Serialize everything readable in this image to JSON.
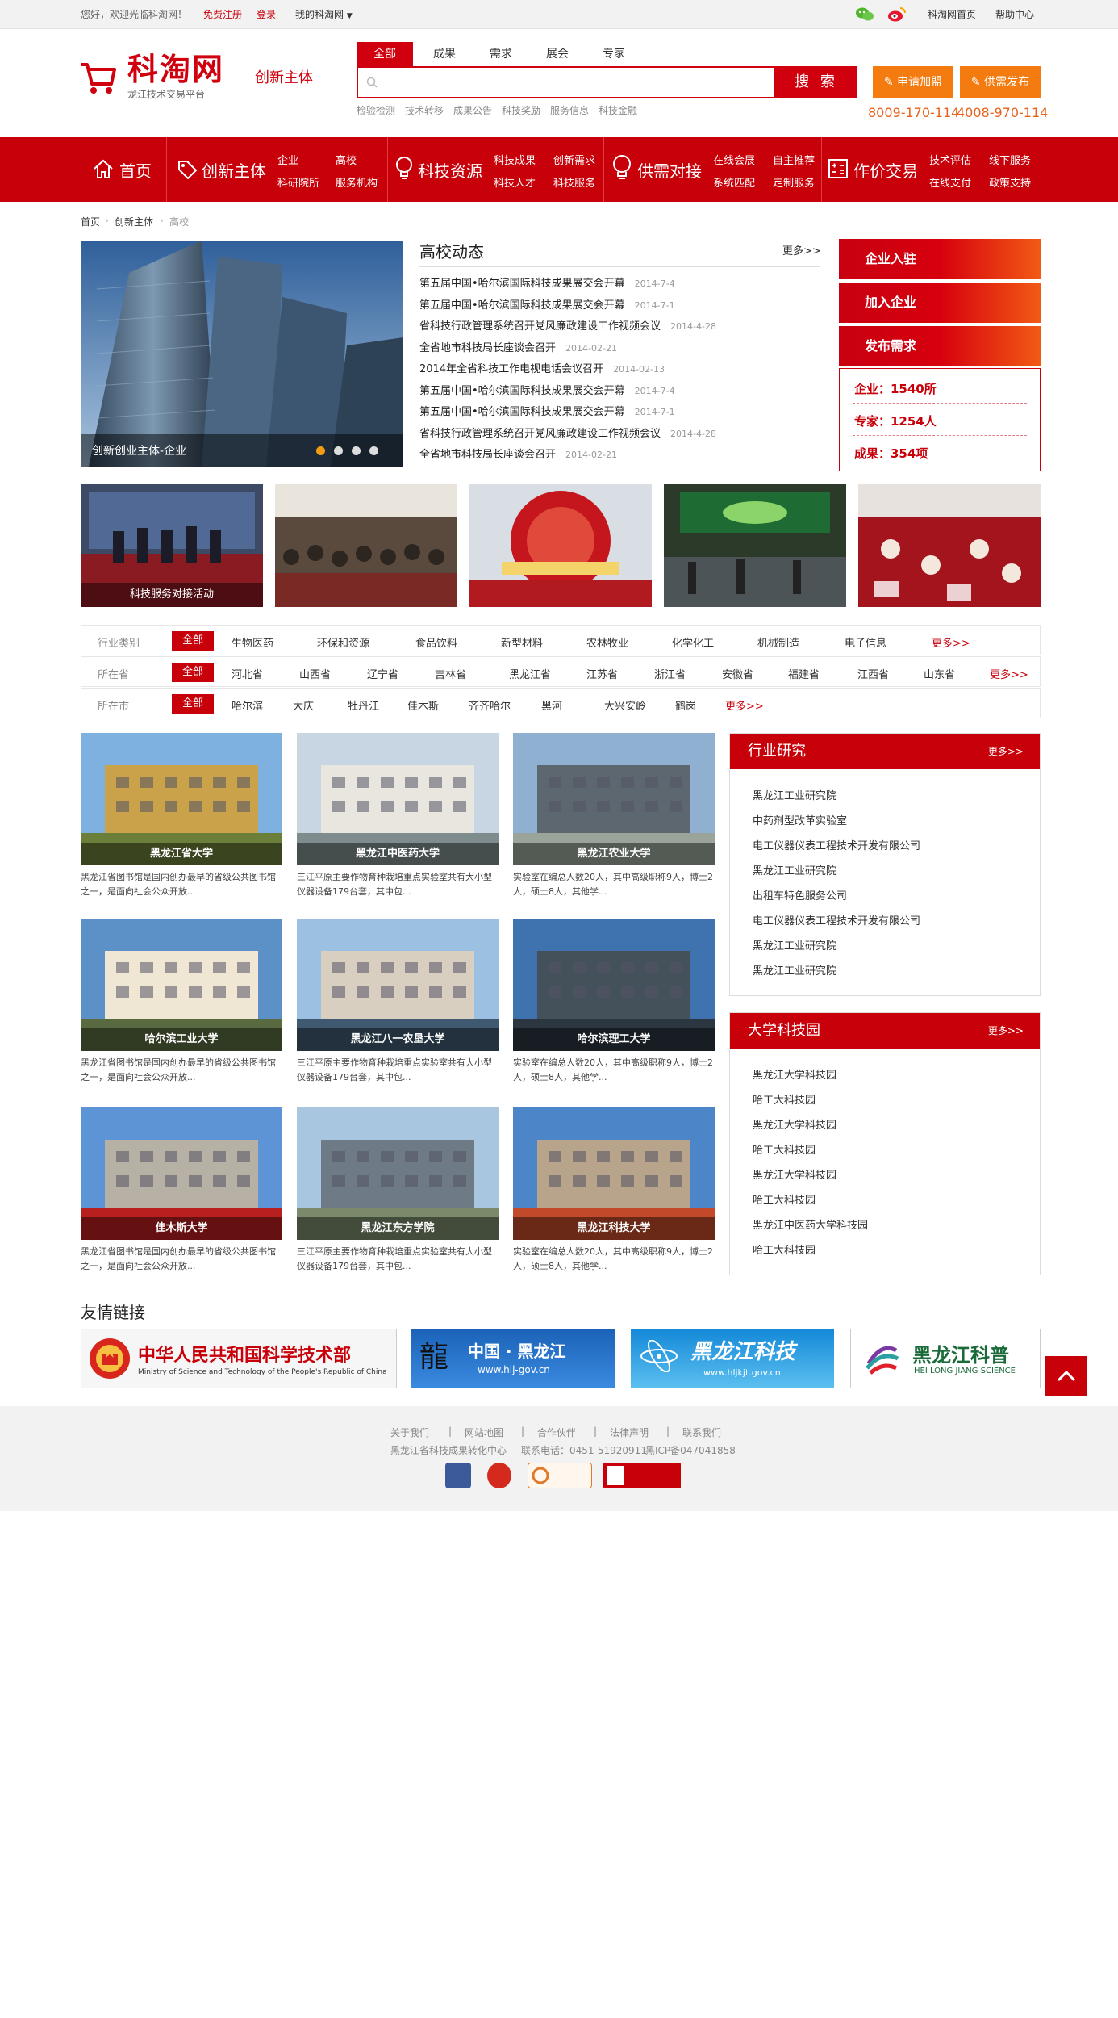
{
  "topbar": {
    "welcome": "您好，欢迎光临科淘网！",
    "register": "免费注册",
    "login": "登录",
    "my": "我的科淘网",
    "home": "科淘网首页",
    "help": "帮助中心"
  },
  "header": {
    "logo": "科淘网",
    "logo_sub": "龙江技术交易平台",
    "section": "创新主体",
    "search_tabs": [
      "全部",
      "成果",
      "需求",
      "展会",
      "专家"
    ],
    "search_button": "搜 索",
    "hot_links": [
      "检验检测",
      "技术转移",
      "成果公告",
      "科技奖励",
      "服务信息",
      "科技金融"
    ],
    "apply_button": "申请加盟",
    "publish_button": "供需发布",
    "phone1": "8009-170-114",
    "phone2": "4008-970-114"
  },
  "nav": {
    "home": "首页",
    "groups": [
      {
        "title": "创新主体",
        "links": [
          "企业",
          "高校",
          "科研院所",
          "服务机构"
        ]
      },
      {
        "title": "科技资源",
        "links": [
          "科技成果",
          "创新需求",
          "科技人才",
          "科技服务"
        ]
      },
      {
        "title": "供需对接",
        "links": [
          "在线会展",
          "自主推荐",
          "系统匹配",
          "定制服务"
        ]
      },
      {
        "title": "作价交易",
        "links": [
          "技术评估",
          "线下服务",
          "在线支付",
          "政策支持"
        ]
      }
    ]
  },
  "breadcrumb": [
    "首页",
    "创新主体",
    "高校"
  ],
  "banner": {
    "caption": "创新创业主体-企业"
  },
  "news": {
    "title": "高校动态",
    "more": "更多>>",
    "items": [
      {
        "text": "第五届中国•哈尔滨国际科技成果展交会开幕",
        "date": "2014-7-4"
      },
      {
        "text": "第五届中国•哈尔滨国际科技成果展交会开幕",
        "date": "2014-7-1"
      },
      {
        "text": "省科技行政管理系统召开党风廉政建设工作视频会议",
        "date": "2014-4-28"
      },
      {
        "text": "全省地市科技局长座谈会召开",
        "date": "2014-02-21"
      },
      {
        "text": "2014年全省科技工作电视电话会议召开",
        "date": "2014-02-13"
      },
      {
        "text": "第五届中国•哈尔滨国际科技成果展交会开幕",
        "date": "2014-7-4"
      },
      {
        "text": "第五届中国•哈尔滨国际科技成果展交会开幕",
        "date": "2014-7-1"
      },
      {
        "text": "省科技行政管理系统召开党风廉政建设工作视频会议",
        "date": "2014-4-28"
      },
      {
        "text": "全省地市科技局长座谈会召开",
        "date": "2014-02-21"
      }
    ]
  },
  "side_buttons": [
    "企业入驻",
    "加入企业",
    "发布需求"
  ],
  "stats": [
    "企业：1540所",
    "专家：1254人",
    "成果：354项"
  ],
  "photo_strip": {
    "caption": "科技服务对接活动"
  },
  "filters": {
    "all": "全部",
    "more": "更多>>",
    "rows": [
      {
        "label": "行业类别",
        "items": [
          "生物医药",
          "环保和资源",
          "食品饮料",
          "新型材料",
          "农林牧业",
          "化学化工",
          "机械制造",
          "电子信息"
        ]
      },
      {
        "label": "所在省",
        "items": [
          "河北省",
          "山西省",
          "辽宁省",
          "吉林省",
          "黑龙江省",
          "江苏省",
          "浙江省",
          "安徽省",
          "福建省",
          "江西省",
          "山东省"
        ]
      },
      {
        "label": "所在市",
        "items": [
          "哈尔滨",
          "大庆",
          "牡丹江",
          "佳木斯",
          "齐齐哈尔",
          "黑河",
          "大兴安岭",
          "鹤岗"
        ]
      }
    ]
  },
  "cards": [
    {
      "name": "黑龙江省大学",
      "desc": "黑龙江省图书馆是国内创办最早的省级公共图书馆之一，是面向社会公众开放..."
    },
    {
      "name": "黑龙江中医药大学",
      "desc": "三江平原主要作物育种栽培重点实验室共有大小型仪器设备179台套，其中包..."
    },
    {
      "name": "黑龙江农业大学",
      "desc": "实验室在编总人数20人，其中高级职称9人，博士2人，硕士8人，其他学..."
    },
    {
      "name": "哈尔滨工业大学",
      "desc": "黑龙江省图书馆是国内创办最早的省级公共图书馆之一，是面向社会公众开放..."
    },
    {
      "name": "黑龙江八一农垦大学",
      "desc": "三江平原主要作物育种栽培重点实验室共有大小型仪器设备179台套，其中包..."
    },
    {
      "name": "哈尔滨理工大学",
      "desc": "实验室在编总人数20人，其中高级职称9人，博士2人，硕士8人，其他学..."
    },
    {
      "name": "佳木斯大学",
      "desc": "黑龙江省图书馆是国内创办最早的省级公共图书馆之一，是面向社会公众开放..."
    },
    {
      "name": "黑龙江东方学院",
      "desc": "三江平原主要作物育种栽培重点实验室共有大小型仪器设备179台套，其中包..."
    },
    {
      "name": "黑龙江科技大学",
      "desc": "实验室在编总人数20人，其中高级职称9人，博士2人，硕士8人，其他学..."
    }
  ],
  "industry": {
    "title": "行业研究",
    "more": "更多>>",
    "items": [
      "黑龙江工业研究院",
      "中药剂型改革实验室",
      "电工仪器仪表工程技术开发有限公司",
      "黑龙江工业研究院",
      "出租车特色服务公司",
      "电工仪器仪表工程技术开发有限公司",
      "黑龙江工业研究院",
      "黑龙江工业研究院"
    ]
  },
  "parks": {
    "title": "大学科技园",
    "more": "更多>>",
    "items": [
      "黑龙江大学科技园",
      "哈工大科技园",
      "黑龙江大学科技园",
      "哈工大科技园",
      "黑龙江大学科技园",
      "哈工大科技园",
      "黑龙江中医药大学科技园",
      "哈工大科技园"
    ]
  },
  "links": {
    "title": "友情链接",
    "most": {
      "cn": "中华人民共和国科学技术部",
      "en": "Ministry of Science and Technology of the People's Republic of China"
    },
    "hlj_gov": {
      "cn": "中国 · 黑龙江",
      "url": "www.hlj-gov.cn"
    },
    "hljkj": {
      "cn": "黑龙江科技",
      "url": "www.hljkjt.gov.cn"
    },
    "kepu": {
      "cn": "黑龙江科普",
      "en": "HEI LONG JIANG SCIENCE"
    }
  },
  "footer": {
    "links": [
      "关于我们",
      "网站地图",
      "合作伙伴",
      "法律声明",
      "联系我们"
    ],
    "org": "黑龙江省科技成果转化中心",
    "tel": "联系电话：0451-51920911",
    "icp": "黑ICP备047041858"
  },
  "colors": {
    "brand_red": "#c8000a",
    "orange": "#f47b0f",
    "gray_bg": "#f2f2f2"
  }
}
